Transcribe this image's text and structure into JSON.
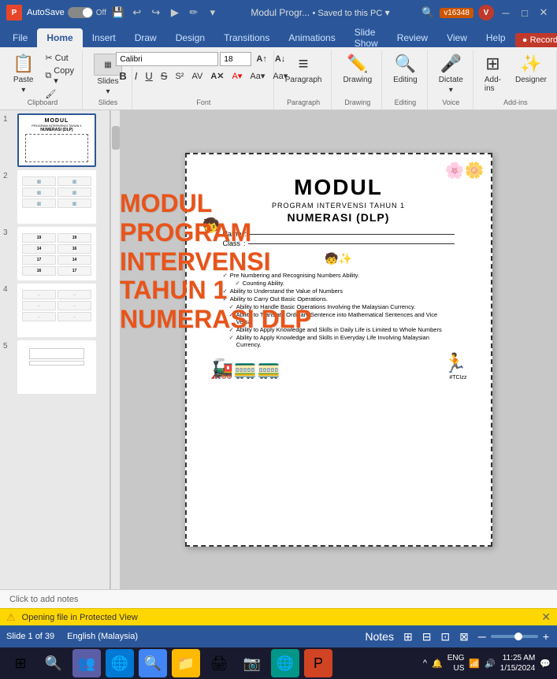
{
  "titlebar": {
    "autosave_label": "AutoSave",
    "toggle_state": "Off",
    "doc_title": "Modul Progr...",
    "save_status": "• Saved to this PC",
    "version": "v16348",
    "user_initial": "V"
  },
  "ribbon": {
    "tabs": [
      "File",
      "Home",
      "Insert",
      "Draw",
      "Design",
      "Transitions",
      "Animations",
      "Slide Show",
      "Review",
      "View",
      "Help"
    ],
    "active_tab": "Home",
    "record_btn": "Record",
    "groups": {
      "clipboard": {
        "label": "Clipboard",
        "paste": "Paste",
        "cut": "✂",
        "copy": "⧉",
        "format_painter": "🖌"
      },
      "slides": {
        "label": "Slides",
        "btn": "Slides"
      },
      "font": {
        "label": "Font",
        "font_name": "Calibri",
        "font_size": "18",
        "bold": "B",
        "italic": "I",
        "underline": "U",
        "strikethrough": "S",
        "clear": "A"
      },
      "paragraph": {
        "label": "Paragraph",
        "btn": "Paragraph"
      },
      "drawing": {
        "label": "Drawing",
        "btn": "Drawing"
      },
      "editing": {
        "label": "Editing",
        "btn": "Editing"
      },
      "voice": {
        "label": "Voice",
        "dictate": "Dictate"
      },
      "addins": {
        "label": "Add-ins",
        "btn": "Add-ins",
        "designer": "Designer"
      }
    }
  },
  "slide_panel": {
    "slides": [
      {
        "num": "1",
        "active": true
      },
      {
        "num": "2",
        "active": false
      },
      {
        "num": "3",
        "active": false
      },
      {
        "num": "4",
        "active": false
      },
      {
        "num": "5",
        "active": false
      }
    ]
  },
  "main_slide": {
    "title": "MODUL",
    "subtitle": "PROGRAM INTERVENSI TAHUN 1",
    "subtitle2": "NUMERASI (DLP)",
    "field1_label": "Name",
    "field1_colon": ":",
    "field2_label": "Class",
    "field2_colon": ":",
    "checklist": [
      "Pre Numbering and Recognising Numbers Ability.",
      "Counting Ability.",
      "Ability to Understand the Value of Numbers",
      "Ability to Carry Out Basic Operations.",
      "Ability to Handle Basic Operations Involving the Malaysian Currency.",
      "Ability to Translate Ordinary Sentence into Mathematical Sentences and Vice Versa.",
      "Ability to Apply Knowledge and Skills in Daily Life is Limited to Whole Numbers",
      "Ability to Apply Knowledge and Skills in Everyday Life Involving Malaysian Currency."
    ],
    "hashtag": "#TCIzz"
  },
  "watermark": {
    "lines": [
      "MODUL PROGRAM",
      "INTERVENSI TAHUN 1",
      "NUMERASI DLP"
    ]
  },
  "notes_bar": {
    "placeholder": "Click to add notes"
  },
  "status_bar": {
    "slide_info": "Slide 1 of 39",
    "language": "English (Malaysia)",
    "zoom_level": "–",
    "notes_btn": "Notes"
  },
  "protected_bar": {
    "message": "Opening file in Protected View",
    "close_label": "✕"
  },
  "taskbar": {
    "search_icon": "🔍",
    "apps": [
      "⊞",
      "👥",
      "🌐",
      "🧭",
      "🔍",
      "📁",
      "🖨",
      "📷",
      "🌐",
      "🔴"
    ],
    "language": "ENG\nUS",
    "wifi_icon": "📶",
    "volume_icon": "🔊"
  }
}
